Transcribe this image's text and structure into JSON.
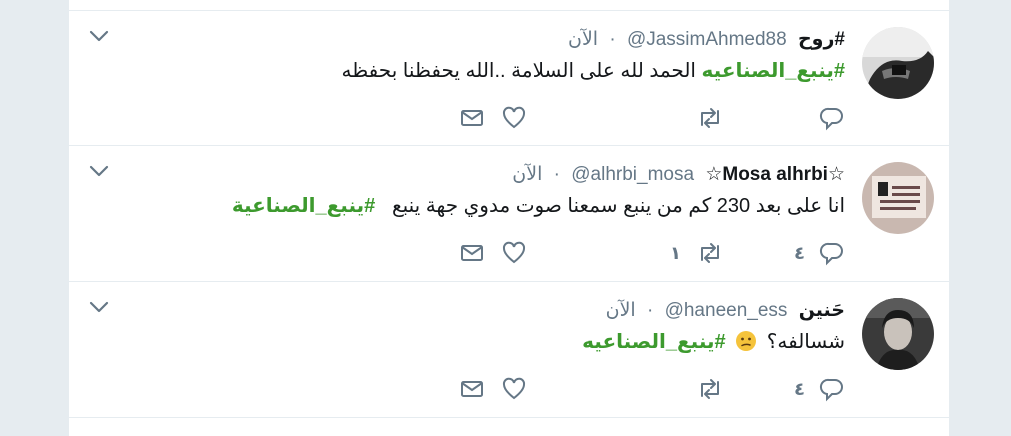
{
  "tweets": [
    {
      "name": "#روح",
      "handle": "@JassimAhmed88",
      "separator": "·",
      "time": "الآن",
      "text_plain": "الحمد لله على السلامة ..الله يحفظنا بحفظه",
      "hashtag": "#ينبع_الصناعيه",
      "reply_count": "",
      "retweet_count": ""
    },
    {
      "name": "☆Mosa alhrbi☆",
      "handle": "@alhrbi_mosa",
      "separator": "·",
      "time": "الآن",
      "text_plain": "انا على بعد 230 كم من ينبع سمعنا صوت مدوي جهة ينبع",
      "hashtag": "#ينبع_الصناعية",
      "reply_count": "٤",
      "retweet_count": "١"
    },
    {
      "name": "حَنين",
      "handle": "@haneen_ess",
      "separator": "·",
      "time": "الآن",
      "text_plain": "شسالفه؟",
      "emoji": "confused-face",
      "hashtag": "#ينبع_الصناعيه",
      "reply_count": "٤",
      "retweet_count": ""
    }
  ],
  "colors": {
    "hashtag": "#3d9a2e",
    "text": "#14171a",
    "muted": "#657786",
    "page_bg": "#e6ecf0"
  },
  "icons": {
    "reply": "reply-icon",
    "retweet": "retweet-icon",
    "like": "heart-icon",
    "dm": "envelope-icon",
    "menu": "chevron-down-icon"
  }
}
